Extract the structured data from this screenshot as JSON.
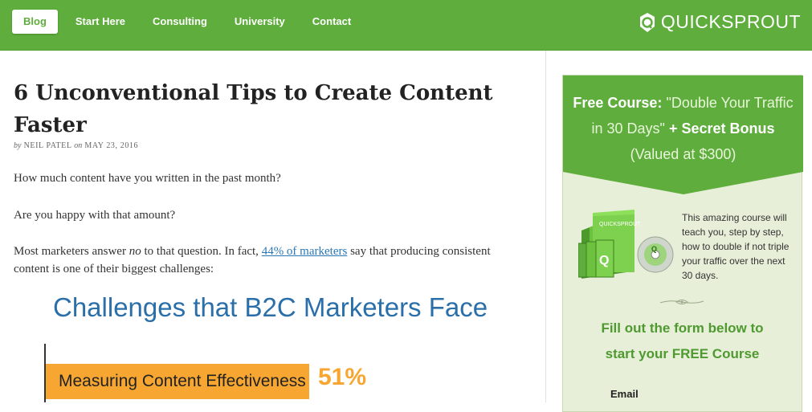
{
  "nav": {
    "items": [
      {
        "label": "Blog"
      },
      {
        "label": "Start Here"
      },
      {
        "label": "Consulting"
      },
      {
        "label": "University"
      },
      {
        "label": "Contact"
      }
    ],
    "brand": "QUICKSPROUT"
  },
  "article": {
    "title": "6 Unconventional Tips to Create Content Faster",
    "byline_prefix": "by",
    "author": "NEIL PATEL",
    "byline_on": "on",
    "date": "MAY 23, 2016",
    "p1": "How much content have you written in the past month?",
    "p2": "Are you happy with that amount?",
    "p3_a": "Most marketers answer ",
    "p3_em": "no",
    "p3_b": " to that question. In fact, ",
    "p3_link": "44% of marketers",
    "p3_c": " say that producing consistent content is one of their biggest challenges:"
  },
  "infographic": {
    "title": "Challenges that B2C Marketers Face",
    "bar_label": "Measuring Content Effectiveness",
    "bar_value": "51%",
    "bar_color": "#f7a731"
  },
  "sidebar": {
    "free_course_label": "Free Course:",
    "course_name_1": "\"Double Your Traffic",
    "course_name_2": "in 30 Days\"",
    "plus": "+",
    "bonus": "Secret Bonus",
    "valued": "(Valued at $300)",
    "desc": "This amazing course will teach you, step by step, how to double if not triple your traffic over the next 30 days.",
    "cta_1": "Fill out the form below to",
    "cta_2": "start your FREE Course",
    "email_label": "Email",
    "product_brand": "QUICKSPROUT"
  },
  "colors": {
    "brand_green": "#5fad3d",
    "link_blue": "#2a77b5",
    "info_blue": "#2a6fa9"
  }
}
